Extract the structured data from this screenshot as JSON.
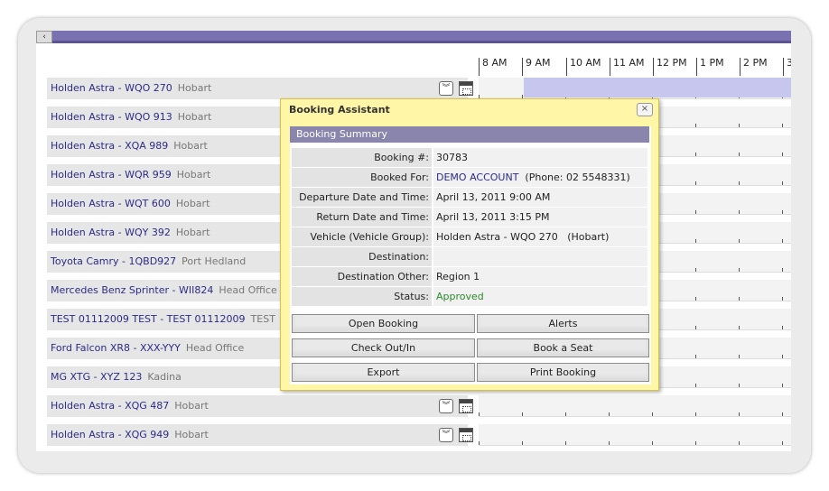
{
  "timeline": {
    "hours": [
      "8 AM",
      "9 AM",
      "10 AM",
      "11 AM",
      "12 PM",
      "1 PM",
      "2 PM",
      "3"
    ]
  },
  "rows": [
    {
      "vehicle": "Holden Astra - WQO 270",
      "location": "Hobart"
    },
    {
      "vehicle": "Holden Astra - WQO 913",
      "location": "Hobart"
    },
    {
      "vehicle": "Holden Astra - XQA 989",
      "location": "Hobart"
    },
    {
      "vehicle": "Holden Astra - WQR 959",
      "location": "Hobart"
    },
    {
      "vehicle": "Holden Astra - WQT 600",
      "location": "Hobart"
    },
    {
      "vehicle": "Holden Astra - WQY 392",
      "location": "Hobart"
    },
    {
      "vehicle": "Toyota Camry - 1QBD927",
      "location": "Port Hedland"
    },
    {
      "vehicle": "Mercedes Benz Sprinter - WII824",
      "location": "Head Office"
    },
    {
      "vehicle": "TEST 01112009 TEST - TEST 01112009",
      "location": "TEST"
    },
    {
      "vehicle": "Ford Falcon XR8 - XXX-YYY",
      "location": "Head Office"
    },
    {
      "vehicle": "MG XTG - XYZ 123",
      "location": "Kadina"
    },
    {
      "vehicle": "Holden Astra - XQG 487",
      "location": "Hobart"
    },
    {
      "vehicle": "Holden Astra - XQG 949",
      "location": "Hobart"
    }
  ],
  "dialog": {
    "title": "Booking Assistant",
    "close_glyph": "×",
    "summary_title": "Booking Summary",
    "fields": {
      "booking_no_label": "Booking #:",
      "booking_no": "30783",
      "booked_for_label": "Booked For:",
      "booked_for_name": "DEMO ACCOUNT",
      "booked_for_phone": "(Phone: 02 5548331)",
      "departure_label": "Departure Date and Time:",
      "departure": "April 13, 2011 9:00 AM",
      "return_label": "Return Date and Time:",
      "return": "April 13, 2011 3:15 PM",
      "vehicle_label": "Vehicle (Vehicle Group):",
      "vehicle": "Holden Astra - WQO 270   (Hobart)",
      "destination_label": "Destination:",
      "destination": "",
      "destination_other_label": "Destination Other:",
      "destination_other": "Region 1",
      "status_label": "Status:",
      "status": "Approved"
    },
    "buttons": {
      "open_booking": "Open Booking",
      "alerts": "Alerts",
      "check_out_in": "Check Out/In",
      "book_a_seat": "Book a Seat",
      "export": "Export",
      "print_booking": "Print Booking"
    }
  },
  "colors": {
    "accent": "#7a72b0",
    "dialog_bg": "#fff6a8",
    "booking_bar": "#c6c6ee",
    "status_ok": "#2c8a2c",
    "link": "#2b2b88"
  },
  "icons": {
    "expand": "double-chevron-down-icon",
    "calendar": "calendar-icon",
    "close": "close-icon"
  }
}
